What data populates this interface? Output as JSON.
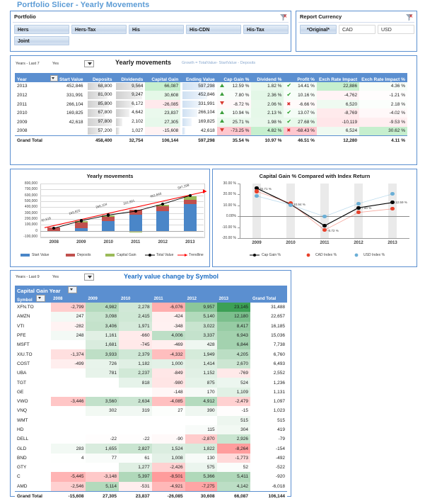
{
  "page_title": "Portfolio Slicer - Yearly Movements",
  "slicers": {
    "portfolio": {
      "header": "Portfolio",
      "clear_icon": "clear-filter-icon",
      "items": [
        {
          "label": "Hers",
          "selected": true
        },
        {
          "label": "Hers-Tax",
          "selected": true
        },
        {
          "label": "His",
          "selected": true
        },
        {
          "label": "His-CDN",
          "selected": true
        },
        {
          "label": "His-Tax",
          "selected": true
        },
        {
          "label": "Joint",
          "selected": true
        }
      ]
    },
    "currency": {
      "header": "Report Currency",
      "clear_icon": "clear-filter-icon",
      "items": [
        {
          "label": "*Original*",
          "selected": true
        },
        {
          "label": "CAD",
          "selected": false
        },
        {
          "label": "USD",
          "selected": false
        }
      ]
    }
  },
  "movements": {
    "slicer_label": "Years - Last 7",
    "slicer_value": "Yes",
    "title": "Yearly movements",
    "formula": "Growth = TotalValue- StartValue - Deposits",
    "columns": [
      "Year",
      "Start Value",
      "Deposits",
      "Dividends",
      "Capital Gain",
      "Ending Value",
      "Cap Gain %",
      "Dividend %",
      "Profit %",
      "Exch Rate Impact",
      "Exch Rate Impact %"
    ],
    "rows": [
      {
        "year": "2013",
        "start": "452,846",
        "deposits": "68,800",
        "dividends": "9,564",
        "cap_gain": "66,087",
        "ending": "597,298",
        "cg_dir": "up",
        "cg_pct": "12.59 %",
        "div_pct": "1.82 %",
        "profit_ic": "check",
        "profit_pct": "14.41 %",
        "fx": "22,886",
        "fx_pct": "4.36 %"
      },
      {
        "year": "2012",
        "start": "331,991",
        "deposits": "81,000",
        "dividends": "9,247",
        "cap_gain": "30,608",
        "ending": "452,846",
        "cg_dir": "up",
        "cg_pct": "7.80 %",
        "div_pct": "2.36 %",
        "profit_ic": "check",
        "profit_pct": "10.16 %",
        "fx": "-4,762",
        "fx_pct": "-1.21 %"
      },
      {
        "year": "2011",
        "start": "266,104",
        "deposits": "85,800",
        "dividends": "6,172",
        "cap_gain": "-26,085",
        "ending": "331,991",
        "cg_dir": "down",
        "cg_pct": "-8.72 %",
        "div_pct": "2.06 %",
        "profit_ic": "cross",
        "profit_pct": "-6.66 %",
        "fx": "6,520",
        "fx_pct": "2.18 %"
      },
      {
        "year": "2010",
        "start": "169,825",
        "deposits": "67,800",
        "dividends": "4,642",
        "cap_gain": "23,837",
        "ending": "266,104",
        "cg_dir": "up",
        "cg_pct": "10.94 %",
        "div_pct": "2.13 %",
        "profit_ic": "check",
        "profit_pct": "13.07 %",
        "fx": "-8,769",
        "fx_pct": "-4.02 %"
      },
      {
        "year": "2009",
        "start": "42,618",
        "deposits": "97,800",
        "dividends": "2,102",
        "cap_gain": "27,305",
        "ending": "169,825",
        "cg_dir": "up",
        "cg_pct": "25.71 %",
        "div_pct": "1.98 %",
        "profit_ic": "check",
        "profit_pct": "27.68 %",
        "fx": "-10,119",
        "fx_pct": "-9.53 %"
      },
      {
        "year": "2008",
        "start": "",
        "deposits": "57,200",
        "dividends": "1,027",
        "cap_gain": "-15,608",
        "ending": "42,618",
        "cg_dir": "down",
        "cg_pct": "-73.25 %",
        "div_pct": "4.82 %",
        "profit_ic": "cross",
        "profit_pct": "-68.43 %",
        "fx": "6,524",
        "fx_pct": "30.62 %"
      }
    ],
    "total": {
      "year": "Grand Total",
      "start": "",
      "deposits": "458,400",
      "dividends": "32,754",
      "cap_gain": "106,144",
      "ending": "597,298",
      "cg_pct": "35.54 %",
      "div_pct": "10.97 %",
      "profit_pct": "46.51 %",
      "fx": "12,280",
      "fx_pct": "4.11 %"
    }
  },
  "symbols": {
    "slicer_label": "Years - Last 9",
    "slicer_value": "Yes",
    "title": "Yearly value change by Symbol",
    "corner_label": "Capital Gain Year",
    "row_label": "Symbol",
    "columns": [
      "2008",
      "2009",
      "2010",
      "2011",
      "2012",
      "2013",
      "Grand Total"
    ],
    "rows": [
      {
        "sym": "XFN.TO",
        "v": [
          "-2,799",
          "4,982",
          "2,278",
          "-6,076",
          "9,957",
          "23,145"
        ],
        "total": "31,488"
      },
      {
        "sym": "AMZN",
        "v": [
          "247",
          "3,098",
          "2,415",
          "-424",
          "5,140",
          "12,180"
        ],
        "total": "22,657"
      },
      {
        "sym": "VTI",
        "v": [
          "-282",
          "3,406",
          "1,971",
          "-348",
          "3,022",
          "8,417"
        ],
        "total": "16,185"
      },
      {
        "sym": "PFE",
        "v": [
          "248",
          "1,161",
          "-660",
          "4,006",
          "3,337",
          "6,943"
        ],
        "total": "15,036"
      },
      {
        "sym": "MSFT",
        "v": [
          "",
          "1,681",
          "-745",
          "-469",
          "428",
          "6,844"
        ],
        "total": "7,738"
      },
      {
        "sym": "XIU.TO",
        "v": [
          "-1,374",
          "3,933",
          "2,379",
          "-4,332",
          "1,949",
          "4,205"
        ],
        "total": "6,760"
      },
      {
        "sym": "COST",
        "v": [
          "-499",
          "726",
          "1,182",
          "1,000",
          "1,414",
          "2,670"
        ],
        "total": "6,493"
      },
      {
        "sym": "UBA",
        "v": [
          "",
          "781",
          "2,237",
          "-849",
          "1,152",
          "-769"
        ],
        "total": "2,552"
      },
      {
        "sym": "TGT",
        "v": [
          "",
          "",
          "818",
          "-980",
          "875",
          "524"
        ],
        "total": "1,236"
      },
      {
        "sym": "GE",
        "v": [
          "",
          "",
          "",
          "-148",
          "170",
          "1,109"
        ],
        "total": "1,131"
      },
      {
        "sym": "VWO",
        "v": [
          "-3,446",
          "3,560",
          "2,634",
          "-4,085",
          "4,912",
          "-2,479"
        ],
        "total": "1,097"
      },
      {
        "sym": "VNQ",
        "v": [
          "",
          "302",
          "319",
          "27",
          "390",
          "-15"
        ],
        "total": "1,023"
      },
      {
        "sym": "WMT",
        "v": [
          "",
          "",
          "",
          "",
          "",
          "515"
        ],
        "total": "515"
      },
      {
        "sym": "HD",
        "v": [
          "",
          "",
          "",
          "",
          "115",
          "304"
        ],
        "total": "419"
      },
      {
        "sym": "DELL",
        "v": [
          "",
          "-22",
          "-22",
          "-90",
          "-2,870",
          "2,926"
        ],
        "total": "-79"
      },
      {
        "sym": "GLD",
        "v": [
          "283",
          "1,655",
          "2,827",
          "1,524",
          "1,822",
          "-8,264"
        ],
        "total": "-154"
      },
      {
        "sym": "BND",
        "v": [
          "4",
          "77",
          "61",
          "1,008",
          "130",
          "-1,773"
        ],
        "total": "-492"
      },
      {
        "sym": "GTY",
        "v": [
          "",
          "",
          "1,277",
          "-2,426",
          "575",
          "52"
        ],
        "total": "-522"
      },
      {
        "sym": "C",
        "v": [
          "-5,445",
          "-3,148",
          "5,397",
          "-8,501",
          "5,366",
          "5,411"
        ],
        "total": "-920"
      },
      {
        "sym": "AMD",
        "v": [
          "-2,546",
          "5,114",
          "-531",
          "-4,921",
          "-7,275",
          "4,142"
        ],
        "total": "-6,018"
      }
    ],
    "total": {
      "label": "Grand Total",
      "v": [
        "-15,608",
        "27,305",
        "23,837",
        "-26,085",
        "30,608",
        "66,087"
      ],
      "total": "106,144"
    }
  },
  "chart_data": [
    {
      "type": "bar",
      "title": "Yearly movements",
      "categories": [
        "2008",
        "2009",
        "2010",
        "2011",
        "2012",
        "2013"
      ],
      "series": [
        {
          "name": "Start Value",
          "values": [
            0,
            42618,
            169825,
            266104,
            331991,
            452846
          ],
          "color": "#4a86c8"
        },
        {
          "name": "Deposits",
          "values": [
            57200,
            97800,
            67800,
            85800,
            81000,
            68800
          ],
          "color": "#c0504d"
        },
        {
          "name": "Capital Gain",
          "values": [
            -15608,
            27305,
            23837,
            -26085,
            30608,
            66087
          ],
          "color": "#9bbb59"
        },
        {
          "name": "Total Value",
          "values": [
            42618,
            169825,
            266104,
            331991,
            452846,
            597298
          ],
          "color": "#000000"
        },
        {
          "name": "Trendline",
          "values": [],
          "color": "#ff0000"
        }
      ],
      "point_labels": [
        "42,618",
        "169,825",
        "266,104",
        "331,991",
        "452,846",
        "597,298"
      ],
      "ylabel": "",
      "xlabel": "",
      "yticks": [
        "800,000",
        "700,000",
        "600,000",
        "500,000",
        "400,000",
        "300,000",
        "200,000",
        "100,000",
        "0",
        "-100,000"
      ],
      "ylim": [
        -100000,
        800000
      ],
      "legend": [
        "Start Value",
        "Deposits",
        "Capital Gain",
        "Total Value",
        "Trendline"
      ],
      "legend_position": "bottom",
      "grid": true
    },
    {
      "type": "line",
      "title": "Capital Gain % Compared with Index Return",
      "categories": [
        "2009",
        "2010",
        "2011",
        "2012",
        "2013"
      ],
      "series": [
        {
          "name": "Cap Gain %",
          "values": [
            25.71,
            10.94,
            -8.72,
            7.8,
            12.59
          ],
          "color": "#000000"
        },
        {
          "name": "CAD Index %",
          "values": [
            22.9,
            11.8,
            -12.6,
            3.5,
            6.8
          ],
          "color": "#e8402a"
        },
        {
          "name": "USD Index %",
          "values": [
            18.6,
            10.4,
            -0.2,
            11.6,
            20.4
          ],
          "color": "#6bafd6"
        }
      ],
      "point_labels": [
        "25.71 %",
        "10.94 %",
        "-8.72 %",
        "7.80 %",
        "12.59 %"
      ],
      "yticks": [
        "30.00 %",
        "20.00 %",
        "10.00 %",
        "0.00%",
        "-10.00 %",
        "-20.00 %"
      ],
      "ylim": [
        -20,
        30
      ],
      "legend": [
        "Cap Gain %",
        "CAD Index %",
        "USD Index %"
      ],
      "legend_position": "bottom",
      "grid": false
    }
  ],
  "colors": {
    "accent": "#5b9bd5",
    "header_blue": "#5b8fd0",
    "panel_border": "#5b8fd0",
    "pos_green": "#c6efce",
    "neg_red": "#ffc7ce",
    "up_arrow": "#3c9e3c",
    "down_arrow": "#d83a30"
  }
}
